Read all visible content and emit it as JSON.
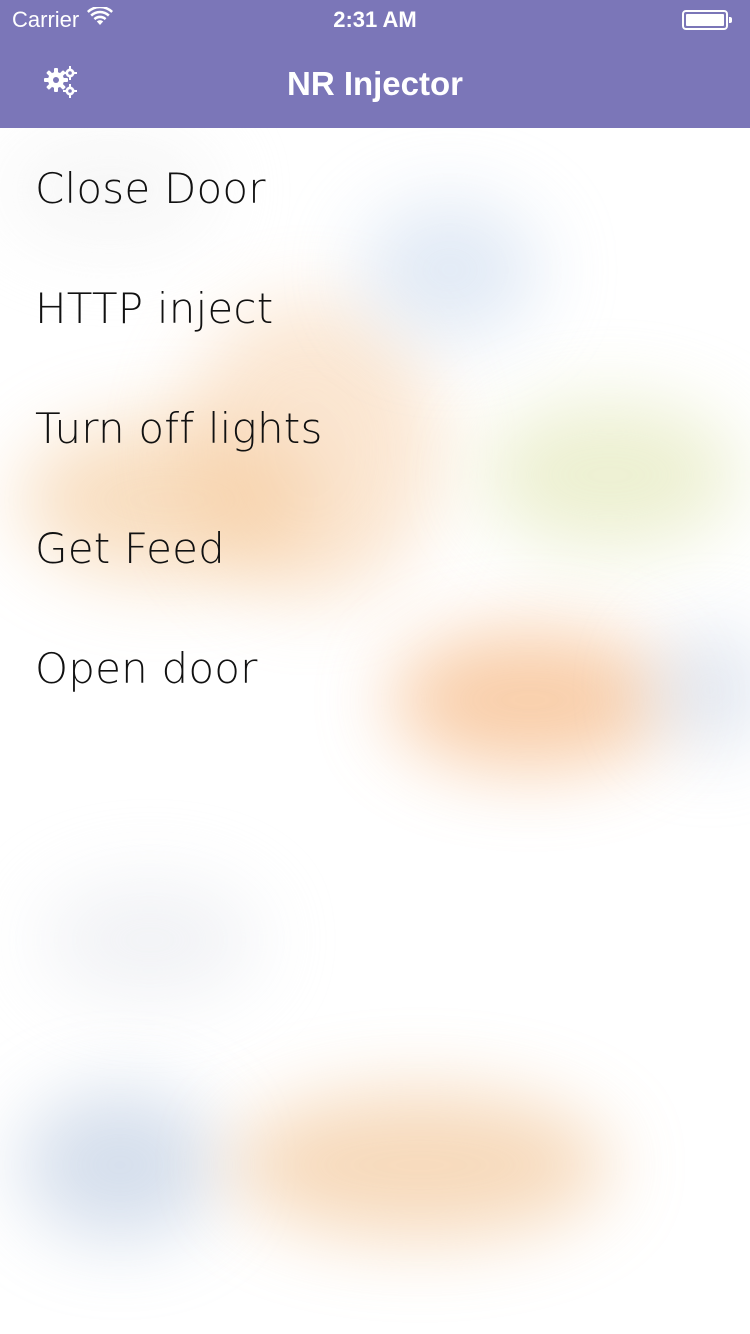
{
  "status_bar": {
    "carrier": "Carrier",
    "time": "2:31 AM"
  },
  "nav": {
    "title": "NR Injector",
    "settings_icon": "gears-icon"
  },
  "list": {
    "items": [
      {
        "label": "Close Door"
      },
      {
        "label": "HTTP inject"
      },
      {
        "label": "Turn off lights"
      },
      {
        "label": "Get Feed"
      },
      {
        "label": "Open door"
      }
    ]
  },
  "colors": {
    "nav_background": "#7b76b8",
    "nav_text": "#ffffff",
    "list_text": "#111111"
  }
}
